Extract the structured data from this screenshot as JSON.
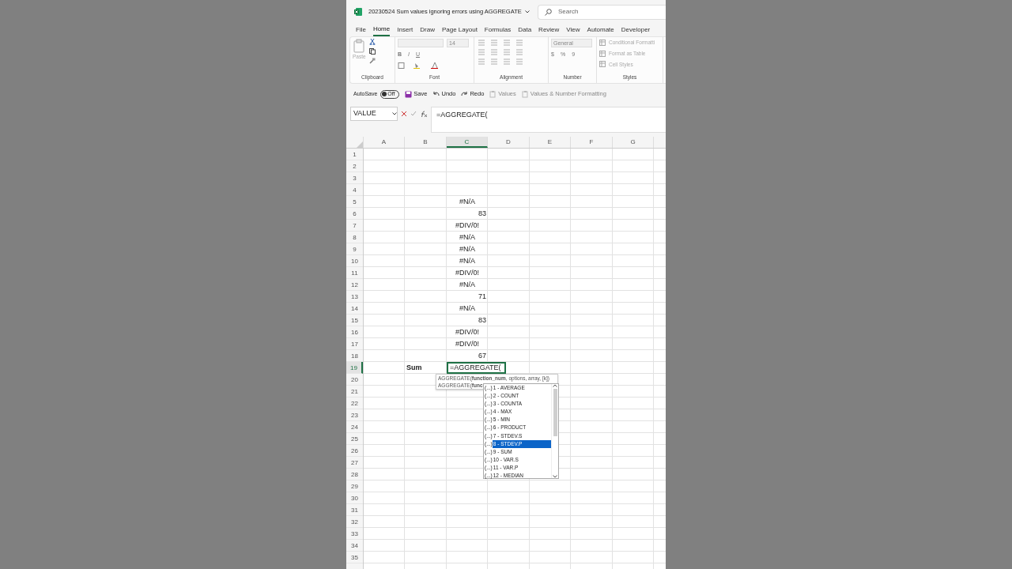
{
  "title_bar": {
    "file_name": "20230524 Sum values ignoring errors using AGGREGATE",
    "search_placeholder": "Search"
  },
  "tabs": [
    {
      "label": "File",
      "selected": false
    },
    {
      "label": "Home",
      "selected": true
    },
    {
      "label": "Insert",
      "selected": false
    },
    {
      "label": "Draw",
      "selected": false
    },
    {
      "label": "Page Layout",
      "selected": false
    },
    {
      "label": "Formulas",
      "selected": false
    },
    {
      "label": "Data",
      "selected": false
    },
    {
      "label": "Review",
      "selected": false
    },
    {
      "label": "View",
      "selected": false
    },
    {
      "label": "Automate",
      "selected": false
    },
    {
      "label": "Developer",
      "selected": false
    }
  ],
  "ribbon": {
    "clipboard": {
      "label": "Clipboard",
      "paste": "Paste"
    },
    "font": {
      "label": "Font",
      "size": "14",
      "buttons": [
        "B",
        "I",
        "U"
      ]
    },
    "alignment": {
      "label": "Alignment"
    },
    "number": {
      "label": "Number",
      "format": "General",
      "symbols": [
        "$",
        "%",
        "9"
      ]
    },
    "styles": {
      "label": "Styles",
      "items": [
        "Conditional Formatti",
        "Format as Table",
        "Cell Styles"
      ]
    }
  },
  "quick_access": {
    "autosave": "AutoSave",
    "autosave_on": false,
    "autosave_state": "Off",
    "items": [
      {
        "kind": "save",
        "label": "Save",
        "disabled": false
      },
      {
        "kind": "undo",
        "label": "Undo",
        "disabled": false
      },
      {
        "kind": "redo",
        "label": "Redo",
        "disabled": false
      },
      {
        "kind": "values",
        "label": "Values",
        "disabled": true
      },
      {
        "kind": "values",
        "label": "Values & Number Formatting",
        "disabled": true
      }
    ]
  },
  "formula_bar": {
    "name_box": "VALUE",
    "formula": "=AGGREGATE("
  },
  "sheet": {
    "columns": [
      {
        "label": "A",
        "selected": false
      },
      {
        "label": "B",
        "selected": false
      },
      {
        "label": "C",
        "selected": true
      },
      {
        "label": "D",
        "selected": false
      },
      {
        "label": "E",
        "selected": false
      },
      {
        "label": "F",
        "selected": false
      },
      {
        "label": "G",
        "selected": false
      }
    ],
    "rows": [
      {
        "number": "1",
        "selected": false
      },
      {
        "number": "2",
        "selected": false
      },
      {
        "number": "3",
        "selected": false
      },
      {
        "number": "4",
        "selected": false
      },
      {
        "number": "5",
        "selected": false,
        "column_c": {
          "text": "#N/A",
          "kind": "error"
        }
      },
      {
        "number": "6",
        "selected": false,
        "column_c": {
          "text": "83",
          "kind": "number"
        }
      },
      {
        "number": "7",
        "selected": false,
        "column_c": {
          "text": "#DIV/0!",
          "kind": "error"
        }
      },
      {
        "number": "8",
        "selected": false,
        "column_c": {
          "text": "#N/A",
          "kind": "error"
        }
      },
      {
        "number": "9",
        "selected": false,
        "column_c": {
          "text": "#N/A",
          "kind": "error"
        }
      },
      {
        "number": "10",
        "selected": false,
        "column_c": {
          "text": "#N/A",
          "kind": "error"
        }
      },
      {
        "number": "11",
        "selected": false,
        "column_c": {
          "text": "#DIV/0!",
          "kind": "error"
        }
      },
      {
        "number": "12",
        "selected": false,
        "column_c": {
          "text": "#N/A",
          "kind": "error"
        }
      },
      {
        "number": "13",
        "selected": false,
        "column_c": {
          "text": "71",
          "kind": "number"
        }
      },
      {
        "number": "14",
        "selected": false,
        "column_c": {
          "text": "#N/A",
          "kind": "error"
        }
      },
      {
        "number": "15",
        "selected": false,
        "column_c": {
          "text": "83",
          "kind": "number"
        }
      },
      {
        "number": "16",
        "selected": false,
        "column_c": {
          "text": "#DIV/0!",
          "kind": "error"
        }
      },
      {
        "number": "17",
        "selected": false,
        "column_c": {
          "text": "#DIV/0!",
          "kind": "error"
        }
      },
      {
        "number": "18",
        "selected": false,
        "column_c": {
          "text": "67",
          "kind": "number"
        }
      },
      {
        "number": "19",
        "selected": true,
        "column_b": {
          "text": "Sum",
          "kind": "label"
        },
        "column_c": {
          "text": "=AGGREGATE(",
          "kind": "editing"
        }
      },
      {
        "number": "20",
        "selected": false
      },
      {
        "number": "21",
        "selected": false
      },
      {
        "number": "22",
        "selected": false
      },
      {
        "number": "23",
        "selected": false
      },
      {
        "number": "24",
        "selected": false
      },
      {
        "number": "25",
        "selected": false
      },
      {
        "number": "26",
        "selected": false
      },
      {
        "number": "27",
        "selected": false
      },
      {
        "number": "28",
        "selected": false
      },
      {
        "number": "29",
        "selected": false
      },
      {
        "number": "30",
        "selected": false
      },
      {
        "number": "31",
        "selected": false
      },
      {
        "number": "32",
        "selected": false
      },
      {
        "number": "33",
        "selected": false
      },
      {
        "number": "34",
        "selected": false
      },
      {
        "number": "35",
        "selected": false
      }
    ]
  },
  "tooltip": {
    "lines": [
      "AGGREGATE(**function_num**, options, array, [k])",
      "AGGREGATE(**func**"
    ]
  },
  "autocomplete": {
    "items": [
      {
        "prefix": "(...)",
        "label": "1 - AVERAGE",
        "selected": false
      },
      {
        "prefix": "(...)",
        "label": "2 - COUNT",
        "selected": false
      },
      {
        "prefix": "(...)",
        "label": "3 - COUNTA",
        "selected": false
      },
      {
        "prefix": "(...)",
        "label": "4 - MAX",
        "selected": false
      },
      {
        "prefix": "(...)",
        "label": "5 - MIN",
        "selected": false
      },
      {
        "prefix": "(...)",
        "label": "6 - PRODUCT",
        "selected": false
      },
      {
        "prefix": "(...)",
        "label": "7 - STDEV.S",
        "selected": false
      },
      {
        "prefix": "(...)",
        "label": "8 - STDEV.P",
        "selected": true
      },
      {
        "prefix": "(...)",
        "label": "9 - SUM",
        "selected": false
      },
      {
        "prefix": "(...)",
        "label": "10 - VAR.S",
        "selected": false
      },
      {
        "prefix": "(...)",
        "label": "11 - VAR.P",
        "selected": false
      },
      {
        "prefix": "(...)",
        "label": "12 - MEDIAN",
        "selected": false
      }
    ]
  }
}
